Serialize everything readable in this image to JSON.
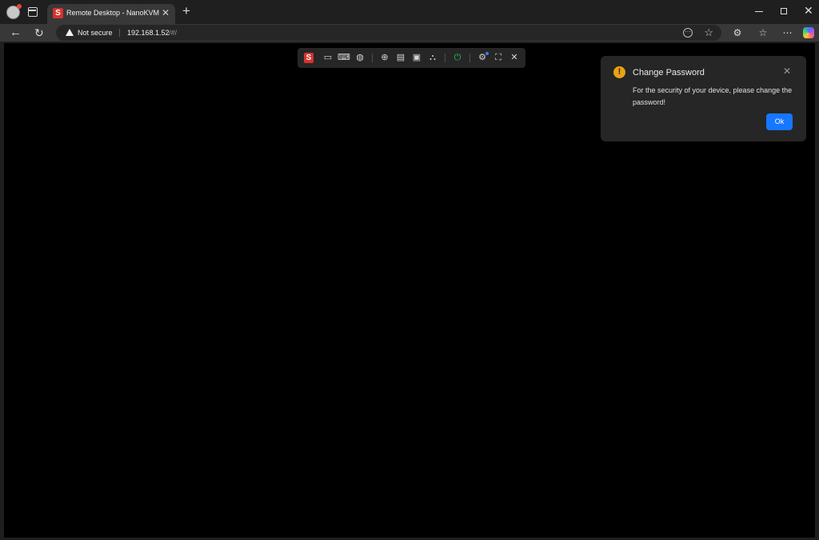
{
  "browser": {
    "tab": {
      "title": "Remote Desktop - NanoKVM",
      "favicon_letter": "S",
      "close_glyph": "✕"
    },
    "new_tab_glyph": "+",
    "address_bar": {
      "security_label": "Not secure",
      "url_host": "192.168.1.52",
      "url_path": "/#/"
    },
    "window_controls": [
      "minimize",
      "maximize",
      "close"
    ]
  },
  "kvm_toolbar": {
    "logo_letter": "S",
    "buttons": [
      "screen-icon",
      "keyboard-icon",
      "mouse-icon",
      "image-mount-icon",
      "script-file-icon",
      "terminal-icon",
      "network-icon",
      "power-icon",
      "settings-icon",
      "fullscreen-icon",
      "close-icon"
    ],
    "colors": {
      "logo": "#d8322c",
      "power": "#2fbf57",
      "notification_dot": "#3a7bff"
    }
  },
  "notification": {
    "title": "Change Password",
    "body": "For the security of your device, please change the password!",
    "ok_label": "Ok",
    "icon_glyph": "!",
    "colors": {
      "warning": "#e8a313",
      "primary": "#1677ff"
    }
  }
}
